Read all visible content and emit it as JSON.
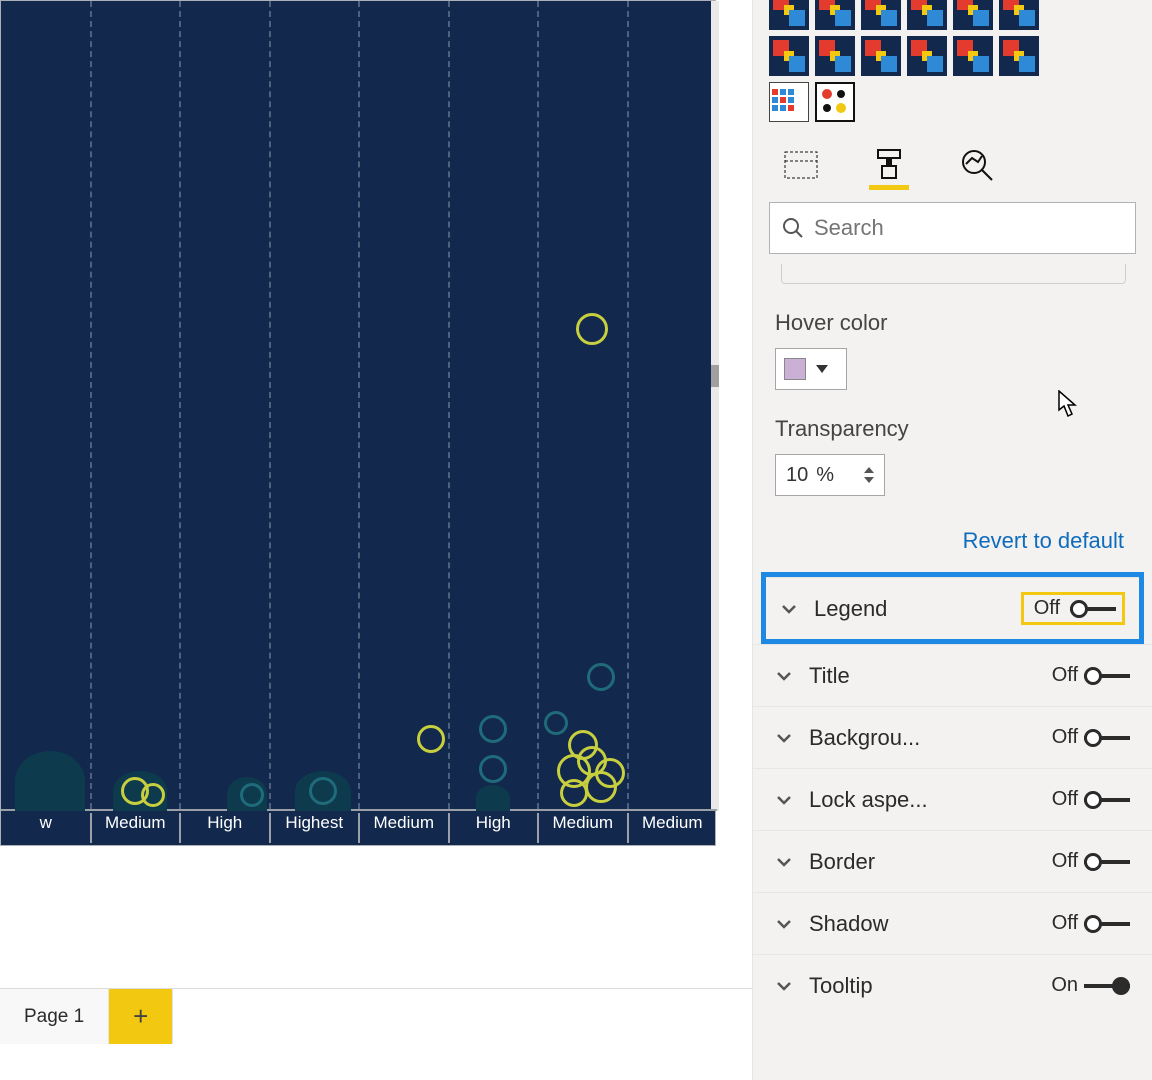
{
  "page_tab": "Page 1",
  "search_placeholder": "Search",
  "properties": {
    "hover_color_label": "Hover color",
    "hover_color_value": "#c9b0d4",
    "transparency_label": "Transparency",
    "transparency_value": "10",
    "transparency_unit": "%",
    "revert_link": "Revert to default"
  },
  "sections": [
    {
      "key": "legend",
      "label": "Legend",
      "state": "Off",
      "on": false,
      "highlight": true
    },
    {
      "key": "title",
      "label": "Title",
      "state": "Off",
      "on": false
    },
    {
      "key": "background",
      "label": "Backgrou...",
      "state": "Off",
      "on": false
    },
    {
      "key": "lockaspect",
      "label": "Lock aspe...",
      "state": "Off",
      "on": false
    },
    {
      "key": "border",
      "label": "Border",
      "state": "Off",
      "on": false
    },
    {
      "key": "shadow",
      "label": "Shadow",
      "state": "Off",
      "on": false
    },
    {
      "key": "tooltip",
      "label": "Tooltip",
      "state": "On",
      "on": true
    }
  ],
  "chart_data": {
    "type": "scatter",
    "note": "partial view of a bubble/scatter visual on dark background; only lower portion visible; y-values are approximate pixel heights above the x-axis (no y tick labels visible)",
    "x_categories": [
      "w",
      "Medium",
      "High",
      "Highest",
      "Medium",
      "High",
      "Medium",
      "Medium"
    ],
    "gridlines_x_index": [
      1,
      2,
      3,
      4,
      5,
      6,
      7
    ],
    "series": [
      {
        "name": "yellow",
        "color": "#c7cf3f",
        "points": [
          {
            "x_index": 6.6,
            "y": 480,
            "r": 16
          },
          {
            "x_index": 4.8,
            "y": 70,
            "r": 14
          },
          {
            "x_index": 6.5,
            "y": 64,
            "r": 15
          },
          {
            "x_index": 6.6,
            "y": 48,
            "r": 15
          },
          {
            "x_index": 6.4,
            "y": 38,
            "r": 17
          },
          {
            "x_index": 6.8,
            "y": 36,
            "r": 15
          },
          {
            "x_index": 6.7,
            "y": 22,
            "r": 16
          },
          {
            "x_index": 6.4,
            "y": 16,
            "r": 14
          },
          {
            "x_index": 1.5,
            "y": 18,
            "r": 14
          },
          {
            "x_index": 1.7,
            "y": 14,
            "r": 12
          }
        ]
      },
      {
        "name": "teal",
        "color": "#1f6b7a",
        "points": [
          {
            "x_index": 6.7,
            "y": 132,
            "r": 14
          },
          {
            "x_index": 5.5,
            "y": 80,
            "r": 14
          },
          {
            "x_index": 5.5,
            "y": 40,
            "r": 14
          },
          {
            "x_index": 6.2,
            "y": 86,
            "r": 12
          },
          {
            "x_index": 2.8,
            "y": 14,
            "r": 12
          },
          {
            "x_index": 3.6,
            "y": 18,
            "r": 14
          }
        ]
      }
    ]
  }
}
